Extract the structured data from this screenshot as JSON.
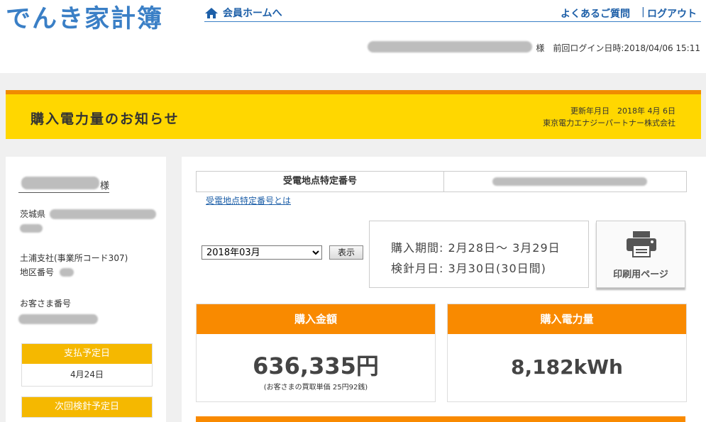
{
  "header": {
    "logo": "でんき家計簿",
    "home_link": "会員ホームへ",
    "faq_link": "よくあるご質問",
    "separator": "|",
    "logout_link": "ログアウト",
    "login_info": "様　前回ログイン日時:2018/04/06 15:11"
  },
  "banner": {
    "title": "購入電力量のお知らせ",
    "updated": "更新年月日　2018年 4月 6日",
    "company": "東京電力エナジーパートナー株式会社"
  },
  "sidebar": {
    "customer_suffix": "様",
    "prefecture": "茨城県",
    "branch": "土浦支社(事業所コード307)",
    "district_label": "地区番号",
    "customer_number_label": "お客さま番号",
    "payment_due_label": "支払予定日",
    "payment_due_value": "4月24日",
    "next_meter_label": "次回検針予定日"
  },
  "main": {
    "spec_label": "受電地点特定番号",
    "spec_link": "受電地点特定番号とは",
    "month_selected": "2018年03月",
    "show_button": "表示",
    "period_line": "購入期間: 2月28日〜 3月29日",
    "meter_line": "検針月日: 3月30日(30日間)",
    "print_label": "印刷用ページ",
    "amount_label": "購入金額",
    "amount_value": "636,335円",
    "amount_note": "(お客さまの買取単価 25円92銭)",
    "energy_label": "購入電力量",
    "energy_value": "8,182kWh"
  },
  "colors": {
    "brand_blue": "#3a7fc6",
    "link_blue": "#1d5fa8",
    "banner_yellow": "#ffd700",
    "accent_orange": "#f98a00",
    "sidebar_gold": "#f5b800"
  }
}
